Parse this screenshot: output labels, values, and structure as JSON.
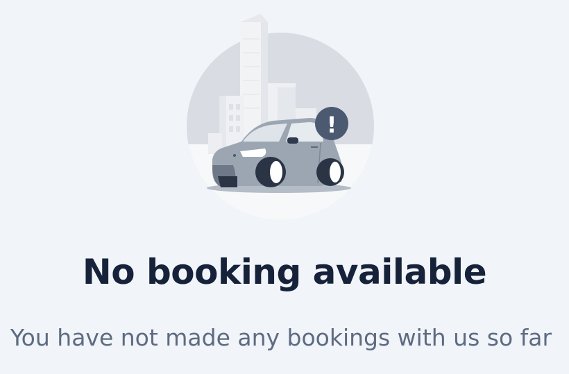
{
  "empty_state": {
    "title": "No booking available",
    "message": "You have not made any bookings with us so far",
    "illustration": {
      "icon": "car-warning-icon",
      "badge_symbol": "!",
      "colors": {
        "circle": "#d9dde3",
        "buildings": "#eceef1",
        "car_body": "#9ca6b3",
        "badge": "#4b5a70",
        "tire": "#2a3444"
      }
    }
  },
  "colors": {
    "background": "#f1f4f8",
    "title": "#16223a",
    "subtitle": "#5d6b82"
  }
}
